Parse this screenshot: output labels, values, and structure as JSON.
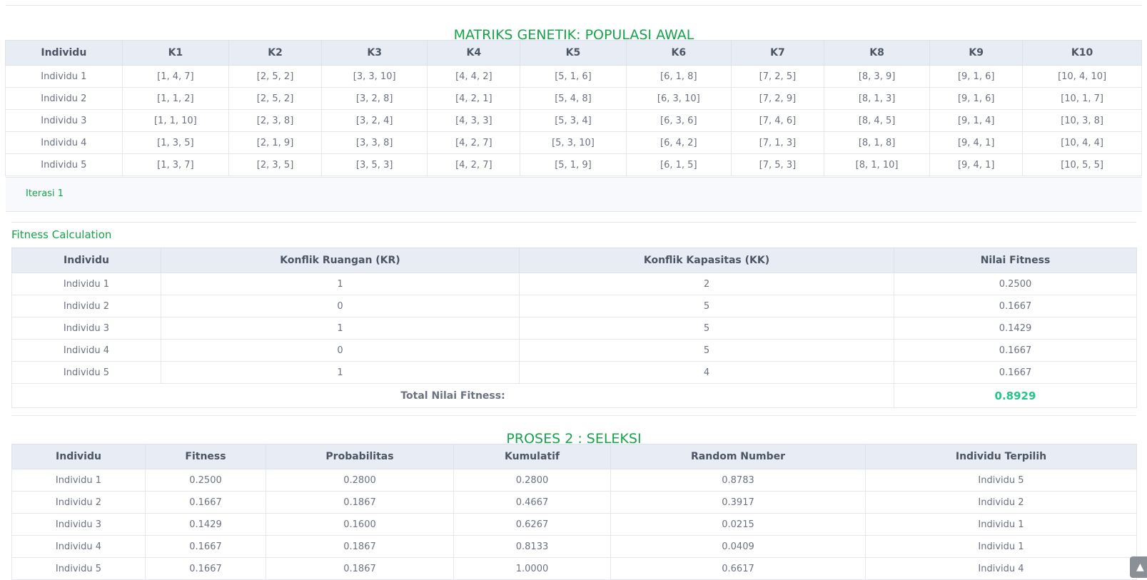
{
  "matrix": {
    "title": "MATRIKS GENETIK: POPULASI AWAL",
    "headers": [
      "Individu",
      "K1",
      "K2",
      "K3",
      "K4",
      "K5",
      "K6",
      "K7",
      "K8",
      "K9",
      "K10"
    ],
    "rows": [
      [
        "Individu 1",
        "[1, 4, 7]",
        "[2, 5, 2]",
        "[3, 3, 10]",
        "[4, 4, 2]",
        "[5, 1, 6]",
        "[6, 1, 8]",
        "[7, 2, 5]",
        "[8, 3, 9]",
        "[9, 1, 6]",
        "[10, 4, 10]"
      ],
      [
        "Individu 2",
        "[1, 1, 2]",
        "[2, 5, 2]",
        "[3, 2, 8]",
        "[4, 2, 1]",
        "[5, 4, 8]",
        "[6, 3, 10]",
        "[7, 2, 9]",
        "[8, 1, 3]",
        "[9, 1, 6]",
        "[10, 1, 7]"
      ],
      [
        "Individu 3",
        "[1, 1, 10]",
        "[2, 3, 8]",
        "[3, 2, 4]",
        "[4, 3, 3]",
        "[5, 3, 4]",
        "[6, 3, 6]",
        "[7, 4, 6]",
        "[8, 4, 5]",
        "[9, 1, 4]",
        "[10, 3, 8]"
      ],
      [
        "Individu 4",
        "[1, 3, 5]",
        "[2, 1, 9]",
        "[3, 3, 8]",
        "[4, 2, 7]",
        "[5, 3, 10]",
        "[6, 4, 2]",
        "[7, 1, 3]",
        "[8, 1, 8]",
        "[9, 4, 1]",
        "[10, 4, 4]"
      ],
      [
        "Individu 5",
        "[1, 3, 7]",
        "[2, 3, 5]",
        "[3, 5, 3]",
        "[4, 2, 7]",
        "[5, 1, 9]",
        "[6, 1, 5]",
        "[7, 5, 3]",
        "[8, 1, 10]",
        "[9, 4, 1]",
        "[10, 5, 5]"
      ]
    ]
  },
  "iteration": {
    "label": "Iterasi 1"
  },
  "fitness": {
    "title": "Fitness Calculation",
    "headers": [
      "Individu",
      "Konflik Ruangan (KR)",
      "Konflik Kapasitas (KK)",
      "Nilai Fitness"
    ],
    "rows": [
      [
        "Individu 1",
        "1",
        "2",
        "0.2500"
      ],
      [
        "Individu 2",
        "0",
        "5",
        "0.1667"
      ],
      [
        "Individu 3",
        "1",
        "5",
        "0.1429"
      ],
      [
        "Individu 4",
        "0",
        "5",
        "0.1667"
      ],
      [
        "Individu 5",
        "1",
        "4",
        "0.1667"
      ]
    ],
    "total_label": "Total Nilai Fitness:",
    "total_value": "0.8929"
  },
  "seleksi": {
    "title": "PROSES 2 : SELEKSI",
    "headers": [
      "Individu",
      "Fitness",
      "Probabilitas",
      "Kumulatif",
      "Random Number",
      "Individu Terpilih"
    ],
    "rows": [
      [
        "Individu 1",
        "0.2500",
        "0.2800",
        "0.2800",
        "0.8783",
        "Individu 5"
      ],
      [
        "Individu 2",
        "0.1667",
        "0.1867",
        "0.4667",
        "0.3917",
        "Individu 2"
      ],
      [
        "Individu 3",
        "0.1429",
        "0.1600",
        "0.6267",
        "0.0215",
        "Individu 1"
      ],
      [
        "Individu 4",
        "0.1667",
        "0.1867",
        "0.8133",
        "0.0409",
        "Individu 1"
      ],
      [
        "Individu 5",
        "0.1667",
        "0.1867",
        "1.0000",
        "0.6617",
        "Individu 4"
      ]
    ]
  },
  "icons": {
    "scroll_top": "chevron-up-icon"
  },
  "colors": {
    "accent_green": "#15a34a",
    "total_green": "#22c58a",
    "header_bg": "#e8ecf4"
  }
}
